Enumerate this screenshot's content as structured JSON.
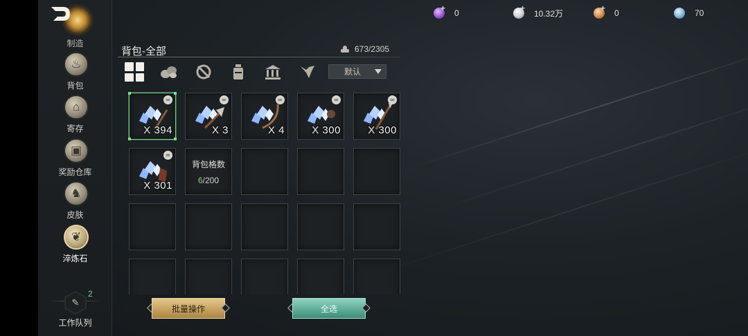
{
  "currencies": [
    {
      "name": "purple-gem-icon",
      "color": "#9b59d0",
      "value": "0"
    },
    {
      "name": "silver-coin-icon",
      "color": "#c9ccd2",
      "value": "10.32万"
    },
    {
      "name": "copper-coin-icon",
      "color": "#d08a4f",
      "value": "0"
    },
    {
      "name": "blue-orb-icon",
      "color": "#7fb3d5",
      "value": "70"
    }
  ],
  "sidebar": {
    "cut_label": "制造",
    "items": [
      {
        "label": "背包",
        "icon": "bag-icon"
      },
      {
        "label": "寄存",
        "icon": "storage-icon"
      },
      {
        "label": "奖励仓库",
        "icon": "reward-chest-icon"
      },
      {
        "label": "皮肤",
        "icon": "armor-icon"
      },
      {
        "label": "淬炼石",
        "icon": "leaf-stone-icon"
      }
    ],
    "queue": {
      "label": "工作队列",
      "badge": "2"
    }
  },
  "panel": {
    "title": "背包-全部",
    "capacity": "673/2305",
    "tabs": [
      "all-grid-icon",
      "materials-icon",
      "gear-icon",
      "potion-icon",
      "building-icon",
      "pet-icon"
    ],
    "sort_label": "默认"
  },
  "slots": [
    {
      "qty": "X 394",
      "selected": true
    },
    {
      "qty": "X 3",
      "selected": false
    },
    {
      "qty": "X 4",
      "selected": false
    },
    {
      "qty": "X 300",
      "selected": false
    },
    {
      "qty": "X 300",
      "selected": false
    },
    {
      "qty": "X 301",
      "selected": false
    }
  ],
  "info_slot": {
    "title": "背包格数",
    "used": "6",
    "total": "/200"
  },
  "buttons": {
    "batch": "批量操作",
    "select_all": "全选"
  },
  "colors": {
    "accent_green": "#6fd07a",
    "gold_button": "#c8a35f",
    "teal_button": "#5fae9b"
  }
}
